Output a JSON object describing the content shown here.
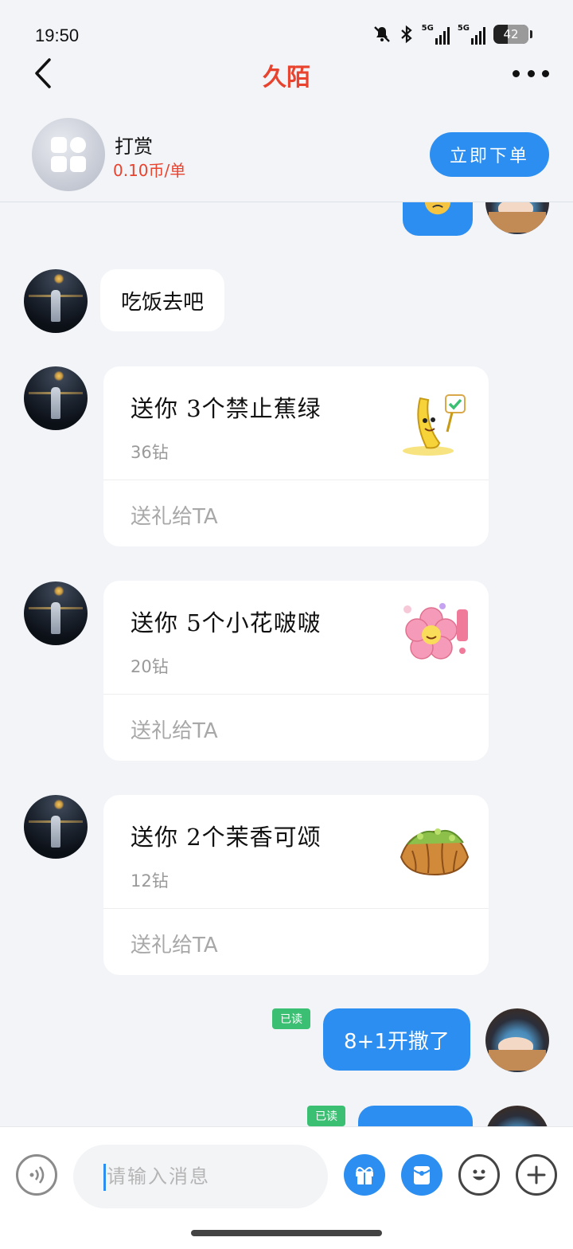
{
  "status": {
    "time": "19:50",
    "battery": "42",
    "net1": "5G",
    "net2": "5G"
  },
  "header": {
    "title": "久陌"
  },
  "service": {
    "name": "打赏",
    "price": "0.10币/单",
    "order_label": "立即下单"
  },
  "messages": {
    "text1": "吃饭去吧",
    "gift1": {
      "title": "送你 3个禁止蕉绿",
      "price": "36钻",
      "action": "送礼给TA"
    },
    "gift2": {
      "title": "送你 5个小花啵啵",
      "price": "20钻",
      "action": "送礼给TA"
    },
    "gift3": {
      "title": "送你 2个茉香可颂",
      "price": "12钻",
      "action": "送礼给TA"
    },
    "read1": "已读",
    "text2": "8+1开撒了",
    "read2": "已读"
  },
  "input": {
    "placeholder": "请输入消息"
  },
  "colors": {
    "accent": "#2b8ef0",
    "title": "#e8432f",
    "read": "#3bbf73"
  }
}
